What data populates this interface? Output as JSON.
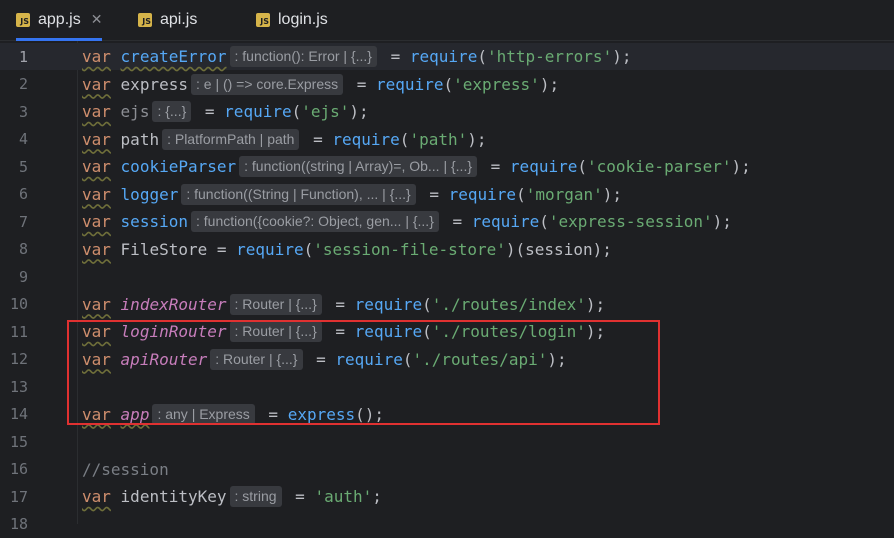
{
  "tabs": [
    {
      "label": "app.js",
      "active": true,
      "closable": true,
      "icon": "JS"
    },
    {
      "label": "api.js",
      "active": false,
      "closable": false,
      "icon": "JS"
    },
    {
      "label": "login.js",
      "active": false,
      "closable": false,
      "icon": "JS"
    }
  ],
  "editor": {
    "lines": [
      {
        "n": "1",
        "kw": "var",
        "name": "createError",
        "hint": ": function(): Error | {...}",
        "eq": " = ",
        "fn": "require",
        "open": "(",
        "str": "'http-errors'",
        "close": ");"
      },
      {
        "n": "2",
        "kw": "var",
        "name": "express",
        "hint": ": e | () => core.Express",
        "eq": " = ",
        "fn": "require",
        "open": "(",
        "str": "'express'",
        "close": ");"
      },
      {
        "n": "3",
        "kw": "var",
        "name": "ejs",
        "hint": ": {...}",
        "eq": " = ",
        "fn": "require",
        "open": "(",
        "str": "'ejs'",
        "close": ");"
      },
      {
        "n": "4",
        "kw": "var",
        "name": "path",
        "hint": ": PlatformPath | path",
        "eq": " = ",
        "fn": "require",
        "open": "(",
        "str": "'path'",
        "close": ");"
      },
      {
        "n": "5",
        "kw": "var",
        "name": "cookieParser",
        "hint": ": function((string | Array)=, Ob... | {...}",
        "eq": " = ",
        "fn": "require",
        "open": "(",
        "str": "'cookie-parser'",
        "close": ");"
      },
      {
        "n": "6",
        "kw": "var",
        "name": "logger",
        "hint": ": function((String | Function), ... | {...}",
        "eq": " = ",
        "fn": "require",
        "open": "(",
        "str": "'morgan'",
        "close": ");"
      },
      {
        "n": "7",
        "kw": "var",
        "name": "session",
        "hint": ": function({cookie?: Object, gen... | {...}",
        "eq": " = ",
        "fn": "require",
        "open": "(",
        "str": "'express-session'",
        "close": ");"
      },
      {
        "n": "8",
        "kw": "var",
        "name": "FileStore",
        "eq": " = ",
        "fn": "require",
        "open": "(",
        "str": "'session-file-store'",
        "close": ")(",
        "arg": "session",
        "end": ");"
      },
      {
        "n": "9"
      },
      {
        "n": "10",
        "kw": "var",
        "name": "indexRouter",
        "hint": ": Router | {...}",
        "eq": " = ",
        "fn": "require",
        "open": "(",
        "str": "'./routes/index'",
        "close": ");"
      },
      {
        "n": "11",
        "kw": "var",
        "name": "loginRouter",
        "hint": ": Router | {...}",
        "eq": " = ",
        "fn": "require",
        "open": "(",
        "str": "'./routes/login'",
        "close": ");"
      },
      {
        "n": "12",
        "kw": "var",
        "name": "apiRouter",
        "hint": ": Router | {...}",
        "eq": " = ",
        "fn": "require",
        "open": "(",
        "str": "'./routes/api'",
        "close": ");"
      },
      {
        "n": "13"
      },
      {
        "n": "14",
        "kw": "var",
        "name": "app",
        "hint": ": any | Express",
        "eq": " = ",
        "fn": "express",
        "open": "(",
        "close": ");"
      },
      {
        "n": "15"
      },
      {
        "n": "16",
        "comment": "//session"
      },
      {
        "n": "17",
        "kw": "var",
        "name": "identityKey",
        "hint": ": string",
        "eq": " = ",
        "str": "'auth'",
        "close": ";"
      },
      {
        "n": "18"
      }
    ]
  },
  "colors": {
    "keyword": "#cf8e6d",
    "string": "#6aab73",
    "function": "#56a8f5",
    "router_var": "#c77dbb",
    "highlight_box": "#e03131"
  }
}
